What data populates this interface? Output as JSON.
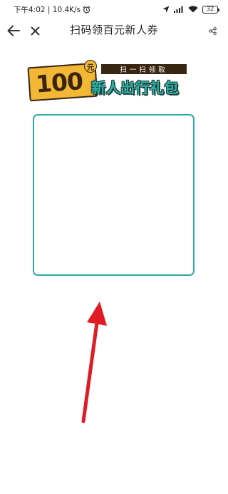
{
  "status_bar": {
    "left_text": "下午4:02 | 10.4K/s",
    "battery": "32"
  },
  "header": {
    "title": "扫码领百元新人券"
  },
  "banner": {
    "amount": "100",
    "unit": "元",
    "tag": "扫一扫领取",
    "headline": "新人出行礼包"
  },
  "colors": {
    "accent_teal": "#2aa9a3",
    "badge_yellow": "#f2b735",
    "badge_dark": "#3a2412",
    "arrow_red": "#e01b24"
  },
  "icons": {
    "back": "arrow-left-icon",
    "close": "close-icon",
    "share": "share-icon",
    "alarm": "alarm-icon",
    "location": "location-arrow-icon",
    "signal": "signal-icon",
    "wifi": "wifi-icon",
    "battery": "battery-icon"
  }
}
